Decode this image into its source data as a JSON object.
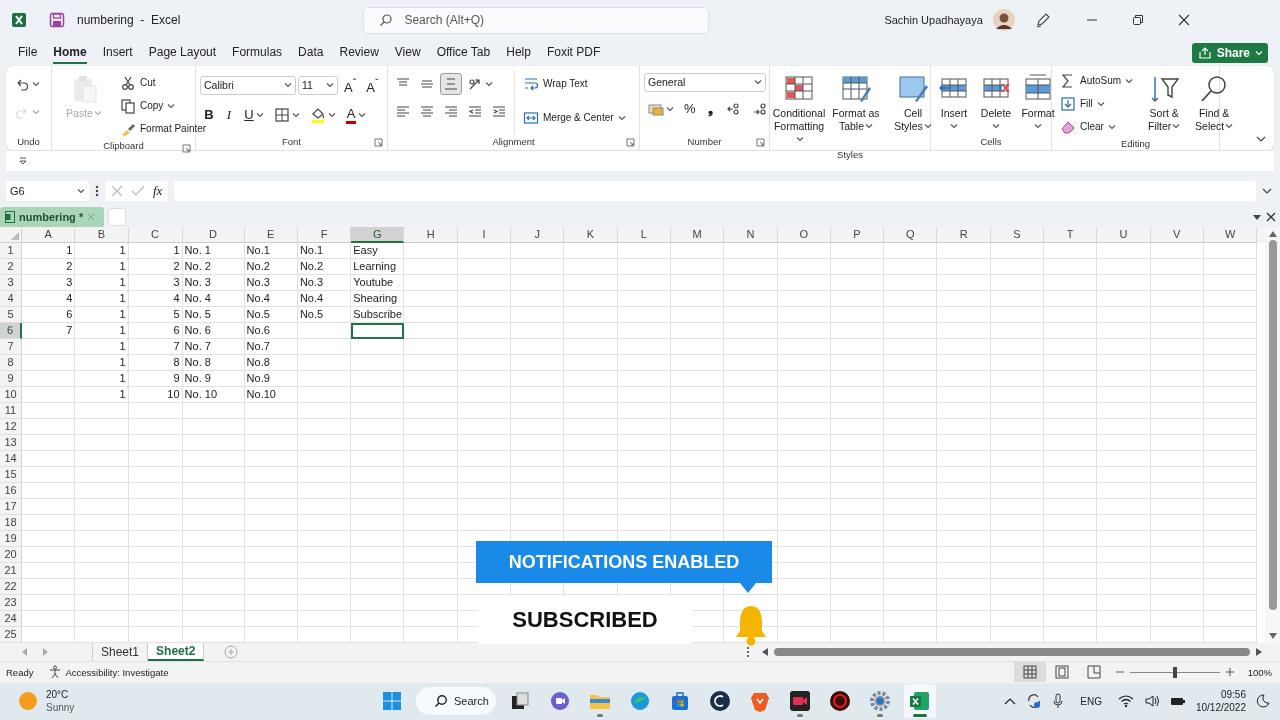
{
  "window": {
    "title": "numbering  -  Excel",
    "search_placeholder": "Search (Alt+Q)",
    "user": "Sachin Upadhayaya"
  },
  "menu": [
    {
      "label": "File",
      "selected": false
    },
    {
      "label": "Home",
      "selected": true
    },
    {
      "label": "Insert",
      "selected": false
    },
    {
      "label": "Page Layout",
      "selected": false
    },
    {
      "label": "Formulas",
      "selected": false
    },
    {
      "label": "Data",
      "selected": false
    },
    {
      "label": "Review",
      "selected": false
    },
    {
      "label": "View",
      "selected": false
    },
    {
      "label": "Office Tab",
      "selected": false
    },
    {
      "label": "Help",
      "selected": false
    },
    {
      "label": "Foxit PDF",
      "selected": false
    }
  ],
  "share": "Share",
  "ribbon": [
    {
      "label": "Undo",
      "columns": [
        [
          [
            {
              "kind": "icon",
              "caret": true,
              "disabled": false
            }
          ],
          [
            {
              "kind": "icon",
              "caret": true,
              "disabled": true
            }
          ]
        ]
      ]
    },
    {
      "label": "Clipboard",
      "launcher": true,
      "columns": [
        [
          [
            {
              "kind": "big",
              "label": "Paste",
              "caret": true,
              "disabled": true
            }
          ]
        ],
        [
          [
            {
              "kind": "small",
              "label": "Cut"
            }
          ],
          [
            {
              "kind": "small",
              "label": "Copy",
              "caret": true
            }
          ],
          [
            {
              "kind": "small",
              "label": "Format Painter"
            }
          ]
        ]
      ]
    },
    {
      "label": "Font",
      "launcher": true,
      "columns": [
        [
          [
            {
              "kind": "dropdown",
              "value": "Calibri"
            },
            {
              "kind": "dropdown",
              "value": "11"
            },
            {
              "kind": "text",
              "label": "A$^{ˆ}$"
            },
            {
              "kind": "text",
              "label": "A$^{ˇ}$"
            }
          ],
          [
            {
              "kind": "bold",
              "label": "B"
            },
            {
              "kind": "italic",
              "label": "I"
            },
            {
              "kind": "underline",
              "label": "U",
              "caret": true
            },
            {
              "kind": "icon",
              "caret": true
            },
            {
              "kind": "icon",
              "caret": true,
              "color": "#ffff00"
            },
            {
              "kind": "text",
              "label": "A",
              "caret": true,
              "color": "#c00000"
            }
          ]
        ]
      ]
    },
    {
      "label": "Alignment",
      "launcher": true,
      "columns": [
        [
          [
            {
              "kind": "icon",
              "selected": false
            },
            {
              "kind": "icon",
              "selected": false
            },
            {
              "kind": "icon",
              "selected": true
            },
            {
              "kind": "icon",
              "caret": true,
              "selected": false
            }
          ],
          [
            {
              "kind": "icon",
              "selected": false
            },
            {
              "kind": "icon",
              "selected": false
            },
            {
              "kind": "icon",
              "selected": false
            },
            {
              "kind": "icon",
              "selected": false
            },
            {
              "kind": "icon",
              "selected": false
            }
          ]
        ],
        [
          [
            {
              "kind": "small",
              "label": "Wrap Text"
            }
          ],
          [
            {
              "kind": "small",
              "label": "Merge & Center",
              "caret": true
            }
          ]
        ]
      ]
    },
    {
      "label": "Number",
      "launcher": true,
      "columns": [
        [
          [
            {
              "kind": "dropdown",
              "value": "General"
            }
          ],
          [
            {
              "kind": "icon",
              "caret": true
            },
            {
              "kind": "text",
              "label": "%"
            },
            {
              "kind": "bold",
              "label": "❟"
            },
            {
              "kind": "icon"
            },
            {
              "kind": "icon"
            }
          ]
        ]
      ]
    },
    {
      "label": "Styles",
      "columns": [
        [
          [
            {
              "kind": "big",
              "label": "Conditional Formatting",
              "caret": true
            }
          ]
        ],
        [
          [
            {
              "kind": "big",
              "label": "Format as Table",
              "caret": true
            }
          ]
        ],
        [
          [
            {
              "kind": "big",
              "label": "Cell Styles",
              "caret": true
            }
          ]
        ]
      ]
    },
    {
      "label": "Cells",
      "columns": [
        [
          [
            {
              "kind": "big",
              "label": "Insert",
              "caret": true
            }
          ]
        ],
        [
          [
            {
              "kind": "big",
              "label": "Delete",
              "caret": true
            }
          ]
        ],
        [
          [
            {
              "kind": "big",
              "label": "Format",
              "caret": true
            }
          ]
        ]
      ]
    },
    {
      "label": "Editing",
      "columns": [
        [
          [
            {
              "kind": "small",
              "label": "AutoSum",
              "caret": true
            }
          ],
          [
            {
              "kind": "small",
              "label": "Fill",
              "caret": true
            }
          ],
          [
            {
              "kind": "small",
              "label": "Clear",
              "caret": true
            }
          ]
        ],
        [
          [
            {
              "kind": "big",
              "label": "Sort & Filter",
              "caret": true
            }
          ]
        ],
        [
          [
            {
              "kind": "big",
              "label": "Find & Select",
              "caret": true
            }
          ]
        ]
      ]
    }
  ],
  "formula_bar": {
    "name_box": "G6",
    "fx": "fx"
  },
  "workbook_tab": {
    "label": "numbering *",
    "selected": true
  },
  "columns": [
    {
      "label": "A",
      "kind": "number",
      "selected": false
    },
    {
      "label": "B",
      "kind": "number",
      "selected": false
    },
    {
      "label": "C",
      "kind": "number",
      "selected": false
    },
    {
      "label": "D",
      "kind": "text",
      "selected": false
    },
    {
      "label": "E",
      "kind": "text",
      "selected": false
    },
    {
      "label": "F",
      "kind": "text",
      "selected": false
    },
    {
      "label": "G",
      "kind": "text",
      "selected": true
    },
    {
      "label": "H",
      "selected": false
    },
    {
      "label": "I",
      "selected": false
    },
    {
      "label": "J",
      "selected": false
    },
    {
      "label": "K",
      "selected": false
    },
    {
      "label": "L",
      "selected": false
    },
    {
      "label": "M",
      "selected": false
    },
    {
      "label": "N",
      "selected": false
    },
    {
      "label": "O",
      "selected": false
    },
    {
      "label": "P",
      "selected": false
    },
    {
      "label": "Q",
      "selected": false
    },
    {
      "label": "R",
      "selected": false
    },
    {
      "label": "S",
      "selected": false
    },
    {
      "label": "T",
      "selected": false
    },
    {
      "label": "U",
      "selected": false
    },
    {
      "label": "V",
      "selected": false
    },
    {
      "label": "W",
      "selected": false
    }
  ],
  "rows": [
    {
      "label": "1",
      "selected": false,
      "cells": [
        "1",
        "1",
        "1",
        "No. 1",
        "No.1",
        "No.1",
        "Easy"
      ]
    },
    {
      "label": "2",
      "selected": false,
      "cells": [
        "2",
        "1",
        "2",
        "No. 2",
        "No.2",
        "No.2",
        "Learning"
      ]
    },
    {
      "label": "3",
      "selected": false,
      "cells": [
        "3",
        "1",
        "3",
        "No. 3",
        "No.3",
        "No.3",
        "Youtube"
      ]
    },
    {
      "label": "4",
      "selected": false,
      "cells": [
        "4",
        "1",
        "4",
        "No. 4",
        "No.4",
        "No.4",
        "Shearing"
      ]
    },
    {
      "label": "5",
      "selected": false,
      "cells": [
        "6",
        "1",
        "5",
        "No. 5",
        "No.5",
        "No.5",
        "Subscribe"
      ]
    },
    {
      "label": "6",
      "selected": true,
      "cells": [
        "7",
        "1",
        "6",
        "No. 6",
        "No.6",
        null,
        null
      ]
    },
    {
      "label": "7",
      "selected": false,
      "cells": [
        null,
        "1",
        "7",
        "No. 7",
        "No.7"
      ]
    },
    {
      "label": "8",
      "selected": false,
      "cells": [
        null,
        "1",
        "8",
        "No. 8",
        "No.8"
      ]
    },
    {
      "label": "9",
      "selected": false,
      "cells": [
        null,
        "1",
        "9",
        "No. 9",
        "No.9"
      ]
    },
    {
      "label": "10",
      "selected": false,
      "cells": [
        null,
        "1",
        "10",
        "No. 10",
        "No.10"
      ]
    },
    {
      "label": "11",
      "selected": false
    },
    {
      "label": "12",
      "selected": false
    },
    {
      "label": "13",
      "selected": false
    },
    {
      "label": "14",
      "selected": false
    },
    {
      "label": "15",
      "selected": false
    },
    {
      "label": "16",
      "selected": false
    },
    {
      "label": "17",
      "selected": false
    },
    {
      "label": "18",
      "selected": false
    },
    {
      "label": "19",
      "selected": false
    },
    {
      "label": "20",
      "selected": false
    },
    {
      "label": "21",
      "selected": false
    },
    {
      "label": "22",
      "selected": false
    },
    {
      "label": "23",
      "selected": false
    },
    {
      "label": "24",
      "selected": false
    },
    {
      "label": "25",
      "selected": false
    }
  ],
  "sheets": [
    {
      "label": "Sheet1",
      "selected": false
    },
    {
      "label": "Sheet2",
      "selected": true
    }
  ],
  "status_bar": {
    "state": "Ready",
    "accessibility": "Accessibility: Investigate",
    "views": [
      {
        "selected": true
      },
      {
        "selected": false
      },
      {
        "selected": false
      }
    ],
    "zoom": {
      "level": 0.5,
      "reading": "100%"
    }
  },
  "overlay": {
    "banner": "NOTIFICATIONS ENABLED",
    "button": "SUBSCRIBED"
  },
  "taskbar": {
    "weather": {
      "temp": "20°C",
      "condition": "Sunny"
    },
    "search": "Search",
    "apps": [
      {
        "running": false,
        "selected": false
      },
      {
        "running": false,
        "selected": false
      },
      {
        "running": false,
        "selected": false
      },
      {
        "running": true,
        "selected": false
      },
      {
        "running": false,
        "selected": false
      },
      {
        "running": false,
        "selected": false
      },
      {
        "running": false,
        "selected": false
      },
      {
        "running": false,
        "selected": false
      },
      {
        "running": true,
        "selected": false
      },
      {
        "running": false,
        "selected": false
      },
      {
        "running": true,
        "selected": false
      },
      {
        "running": true,
        "selected": true
      }
    ],
    "language": "ENG",
    "time": "09:56",
    "date": "10/12/2022"
  }
}
